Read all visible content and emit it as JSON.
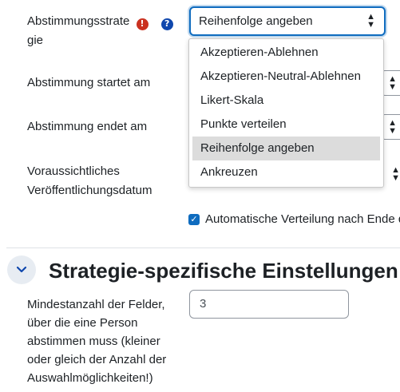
{
  "fields": {
    "strategy_label_line1": "Abstimmungsstrate",
    "strategy_label_line2": "gie",
    "start_label": "Abstimmung startet am",
    "end_label": "Abstimmung endet am",
    "publish_label_line1": "Voraussichtliches",
    "publish_label_line2": "Veröffentlichungsdatum",
    "required_mark": "!",
    "help_mark": "?"
  },
  "strategy_select": {
    "value": "Reihenfolge angeben",
    "arrow": "◆",
    "options": [
      {
        "label": "Akzeptieren-Ablehnen",
        "selected": false
      },
      {
        "label": "Akzeptieren-Neutral-Ablehnen",
        "selected": false
      },
      {
        "label": "Likert-Skala",
        "selected": false
      },
      {
        "label": "Punkte verteilen",
        "selected": false
      },
      {
        "label": "Reihenfolge angeben",
        "selected": true
      },
      {
        "label": "Ankreuzen",
        "selected": false
      }
    ]
  },
  "auto_distribution": {
    "checked": true,
    "label": "Automatische Verteilung nach Ende d"
  },
  "section": {
    "title": "Strategie-spezifische Einstellungen"
  },
  "min_fields": {
    "label_lines": [
      "Mindestanzahl der Felder,",
      "über die eine Person",
      "abstimmen muss (kleiner",
      "oder gleich der Anzahl der",
      "Auswahlmöglichkeiten!)"
    ],
    "value": "3"
  },
  "colors": {
    "accent": "#0f6cbf",
    "required": "#ca3120",
    "help": "#0f47ad"
  }
}
